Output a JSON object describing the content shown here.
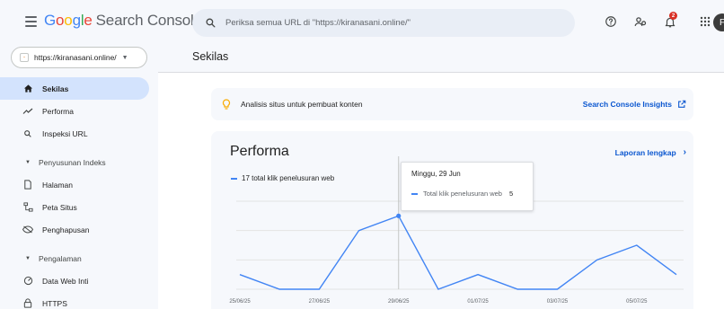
{
  "header": {
    "logo_word": "Google",
    "product": "Search Console",
    "search_placeholder": "Periksa semua URL di \"https://kiranasani.online/\"",
    "notification_count": "2",
    "avatar_letter": "F"
  },
  "brand_colors": [
    "#4285f4",
    "#ea4335",
    "#fbbc05",
    "#34a853"
  ],
  "sidebar": {
    "property": "https://kiranasani.online/",
    "items_top": [
      {
        "label": "Sekilas",
        "icon": "home-icon",
        "active": true
      },
      {
        "label": "Performa",
        "icon": "trending-icon"
      },
      {
        "label": "Inspeksi URL",
        "icon": "search-icon"
      }
    ],
    "section_index": "Penyusunan Indeks",
    "items_index": [
      {
        "label": "Halaman",
        "icon": "pages-icon"
      },
      {
        "label": "Peta Situs",
        "icon": "sitemap-icon"
      },
      {
        "label": "Penghapusan",
        "icon": "removal-icon"
      }
    ],
    "section_experience": "Pengalaman",
    "items_experience": [
      {
        "label": "Data Web Inti",
        "icon": "gauge-icon"
      },
      {
        "label": "HTTPS",
        "icon": "lock-icon"
      }
    ]
  },
  "main": {
    "page_title": "Sekilas",
    "insights_text": "Analisis situs untuk pembuat konten",
    "insights_link": "Search Console Insights",
    "perf_title": "Performa",
    "perf_link": "Laporan lengkap",
    "legend": "17 total klik penelusuran web",
    "tooltip_date": "Minggu, 29 Jun",
    "tooltip_label": "Total klik penelusuran web",
    "tooltip_value": "5"
  },
  "chart_data": {
    "type": "line",
    "series": [
      {
        "name": "Total klik penelusuran web",
        "x": [
          "25/06/25",
          "26/06/25",
          "27/06/25",
          "28/06/25",
          "29/06/25",
          "30/06/25",
          "01/07/25",
          "02/07/25",
          "03/07/25",
          "04/07/25",
          "05/07/25",
          "06/07/25"
        ],
        "values": [
          1,
          0,
          0,
          4,
          5,
          0,
          1,
          0,
          0,
          2,
          3,
          1
        ]
      }
    ],
    "x_tick_labels": [
      "25/06/25",
      "27/06/25",
      "29/06/25",
      "01/07/25",
      "03/07/25",
      "05/07/25"
    ],
    "y_ticks": [
      0,
      2,
      4,
      6
    ],
    "ylim": [
      0,
      6
    ],
    "color": "#4285f4",
    "highlight_index": 4,
    "grid": true
  }
}
